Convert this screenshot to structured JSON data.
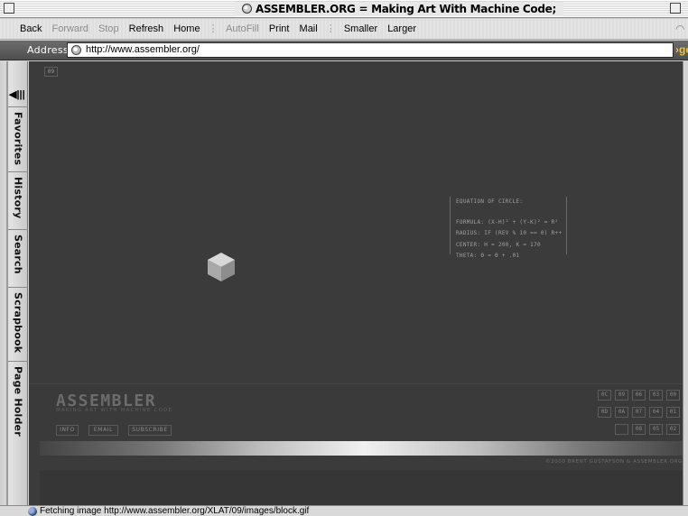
{
  "window": {
    "title": "ASSEMBLER.ORG = Making Art With Machine Code;"
  },
  "toolbar": {
    "back": "Back",
    "forward": "Forward",
    "stop": "Stop",
    "refresh": "Refresh",
    "home": "Home",
    "autofill": "AutoFill",
    "print": "Print",
    "mail": "Mail",
    "smaller": "Smaller",
    "larger": "Larger"
  },
  "address": {
    "label": "Address:",
    "url": "http://www.assembler.org/",
    "go": "go"
  },
  "sidebar": {
    "tabs": [
      "Favorites",
      "History",
      "Search",
      "Scrapbook",
      "Page Holder"
    ]
  },
  "page": {
    "section_tag": "09",
    "equation": {
      "title": "EQUATION OF CIRCLE:",
      "formula": "FORMULA: (X-H)² + (Y-K)² = R²",
      "radius": "RADIUS: IF (REV % 10 == 0) R++",
      "center": "CENTER: H = 200,  K = 170",
      "theta": "THETA: Θ = Θ + .01"
    },
    "logo": {
      "name": "ASSEMBLER",
      "tagline": "MAKING ART WITH MACHINE CODE"
    },
    "footer_links": [
      "INFO",
      "EMAIL",
      "SUBSCRIBE"
    ],
    "grid": [
      [
        "0C",
        "09",
        "06",
        "03",
        "00"
      ],
      [
        "0D",
        "0A",
        "07",
        "04",
        "01"
      ],
      [
        "",
        "",
        "08",
        "05",
        "02"
      ]
    ],
    "copyright": "©2000 BRENT GUSTAFSON & ASSEMBLER.ORG"
  },
  "status": {
    "text": "Fetching image http://www.assembler.org/XLAT/09/images/block.gif"
  },
  "colors": {
    "page_background": "#3b3b3b",
    "address_bar": "#5a5a5a",
    "go_accent": "#f0c040"
  }
}
